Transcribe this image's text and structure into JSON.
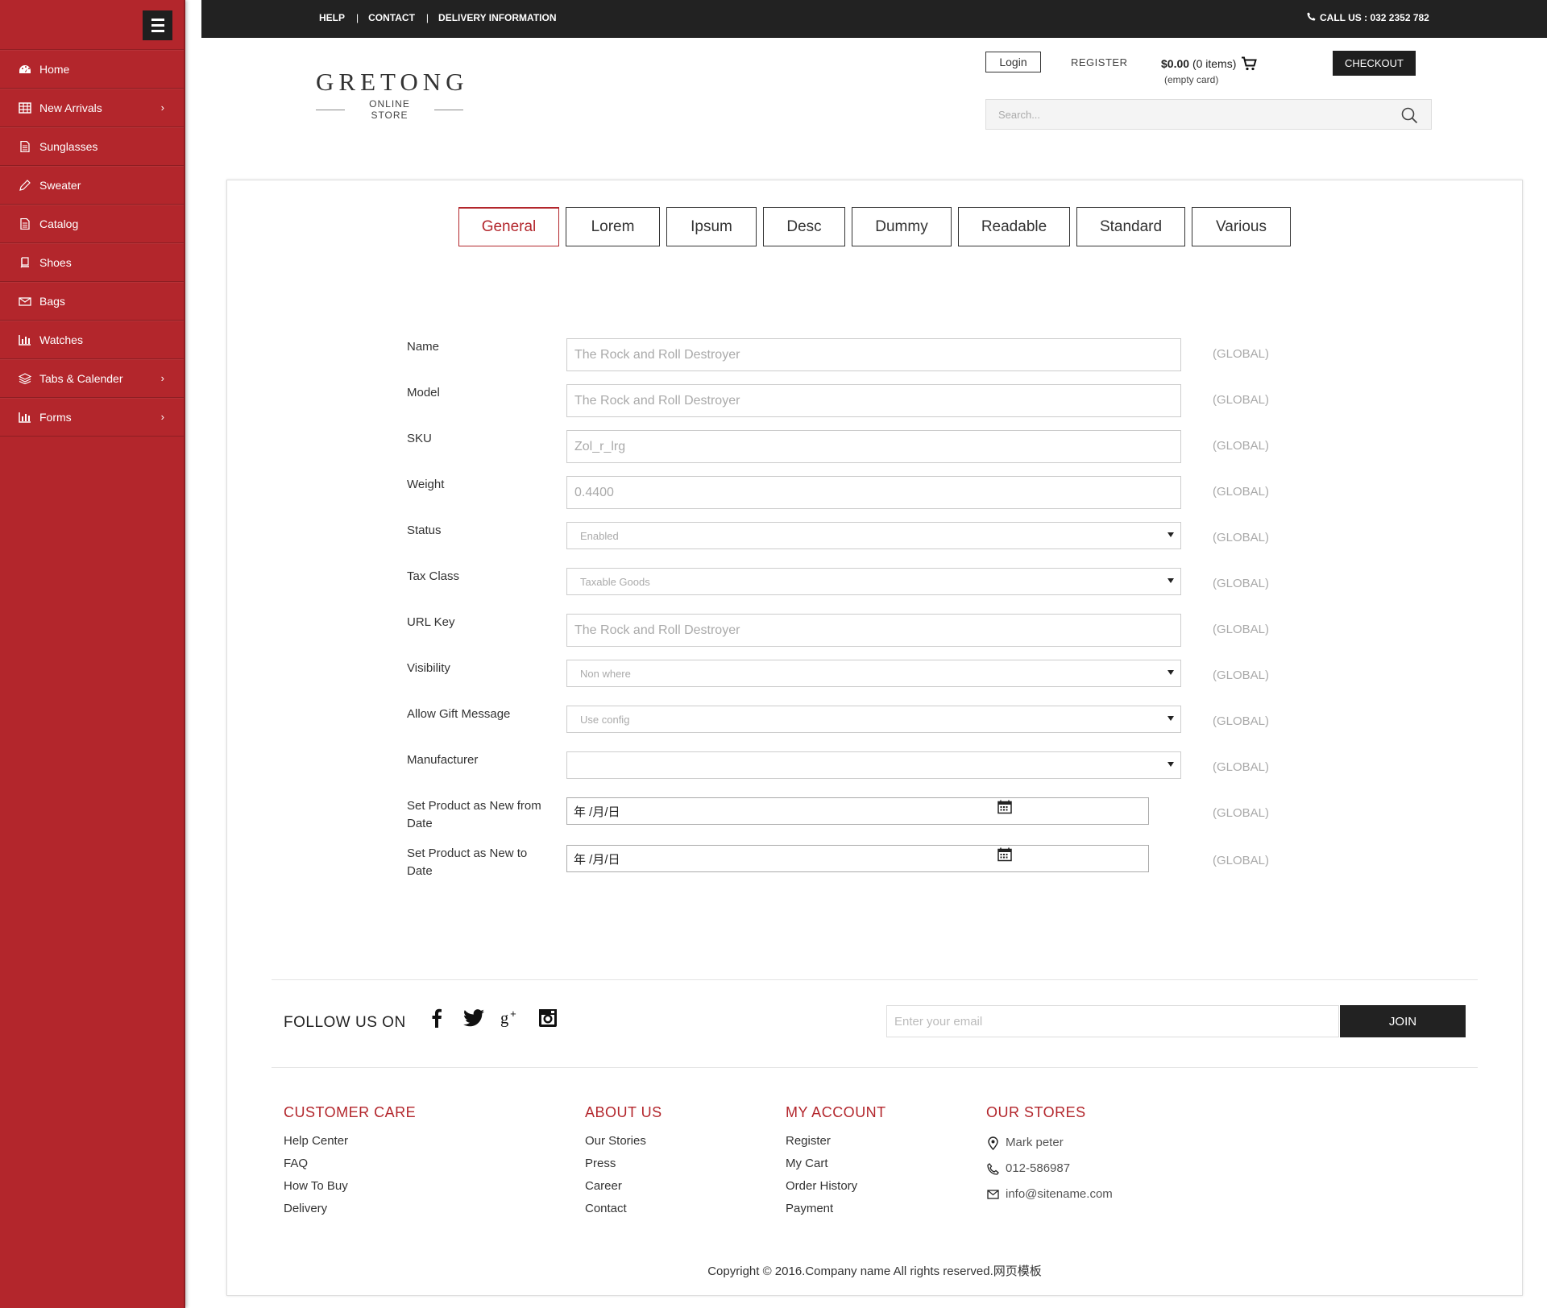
{
  "sidebar": {
    "items": [
      {
        "label": "Home",
        "icon": "dashboard-icon",
        "has_submenu": false
      },
      {
        "label": "New Arrivals",
        "icon": "table-icon",
        "has_submenu": true
      },
      {
        "label": "Sunglasses",
        "icon": "document-icon",
        "has_submenu": false
      },
      {
        "label": "Sweater",
        "icon": "pencil-icon",
        "has_submenu": false
      },
      {
        "label": "Catalog",
        "icon": "document-icon",
        "has_submenu": false
      },
      {
        "label": "Shoes",
        "icon": "book-icon",
        "has_submenu": false
      },
      {
        "label": "Bags",
        "icon": "envelope-icon",
        "has_submenu": false
      },
      {
        "label": "Watches",
        "icon": "bar-chart-icon",
        "has_submenu": false
      },
      {
        "label": "Tabs & Calender",
        "icon": "layers-icon",
        "has_submenu": true
      },
      {
        "label": "Forms",
        "icon": "bar-chart-icon",
        "has_submenu": true
      }
    ],
    "chevron": "›"
  },
  "topbar": {
    "links": [
      "HELP",
      "CONTACT",
      "DELIVERY INFORMATION"
    ],
    "separator": "|",
    "call": "CALL US : 032 2352 782"
  },
  "header": {
    "brand": "GRETONG",
    "brand_sub": "ONLINE STORE",
    "login": "Login",
    "register": "REGISTER",
    "cart_total": "$0.00",
    "cart_items": "(0 items)",
    "cart_status": "(empty card)",
    "checkout": "CHECKOUT",
    "search_placeholder": "Search..."
  },
  "tabs": [
    {
      "label": "General",
      "active": true
    },
    {
      "label": "Lorem",
      "active": false
    },
    {
      "label": "Ipsum",
      "active": false
    },
    {
      "label": "Desc",
      "active": false
    },
    {
      "label": "Dummy",
      "active": false
    },
    {
      "label": "Readable",
      "active": false
    },
    {
      "label": "Standard",
      "active": false
    },
    {
      "label": "Various",
      "active": false
    }
  ],
  "form": {
    "scope_label": "(GLOBAL)",
    "fields": [
      {
        "label": "Name",
        "type": "text",
        "value": "The Rock and Roll Destroyer"
      },
      {
        "label": "Model",
        "type": "text",
        "value": "The Rock and Roll Destroyer"
      },
      {
        "label": "SKU",
        "type": "text",
        "value": "Zol_r_lrg"
      },
      {
        "label": "Weight",
        "type": "text",
        "value": "0.4400"
      },
      {
        "label": "Status",
        "type": "select",
        "value": "Enabled"
      },
      {
        "label": "Tax Class",
        "type": "select",
        "value": "Taxable Goods"
      },
      {
        "label": "URL Key",
        "type": "text",
        "value": "The Rock and Roll Destroyer"
      },
      {
        "label": "Visibility",
        "type": "select",
        "value": "Non where"
      },
      {
        "label": "Allow Gift Message",
        "type": "select",
        "value": "Use config"
      },
      {
        "label": "Manufacturer",
        "type": "select",
        "value": ""
      },
      {
        "label": "Set Product as New from Date",
        "type": "date",
        "value": "年 /月/日"
      },
      {
        "label": "Set Product as New to Date",
        "type": "date",
        "value": "年 /月/日"
      }
    ]
  },
  "footer": {
    "follow_label": "FOLLOW US ON",
    "socials": [
      "facebook-icon",
      "twitter-icon",
      "google-plus-icon",
      "instagram-icon"
    ],
    "email_placeholder": "Enter your email",
    "join": "JOIN",
    "columns": [
      {
        "title": "CUSTOMER CARE",
        "links": [
          "Help Center",
          "FAQ",
          "How To Buy",
          "Delivery"
        ]
      },
      {
        "title": "ABOUT US",
        "links": [
          "Our Stories",
          "Press",
          "Career",
          "Contact"
        ]
      },
      {
        "title": "MY ACCOUNT",
        "links": [
          "Register",
          "My Cart",
          "Order History",
          "Payment"
        ]
      }
    ],
    "stores": {
      "title": "OUR STORES",
      "name": "Mark peter",
      "phone": "012-586987",
      "email": "info@sitename.com"
    },
    "copyright": "Copyright © 2016.Company name All rights reserved.网页模板"
  },
  "colors": {
    "accent": "#b3262c",
    "dark": "#222222"
  }
}
